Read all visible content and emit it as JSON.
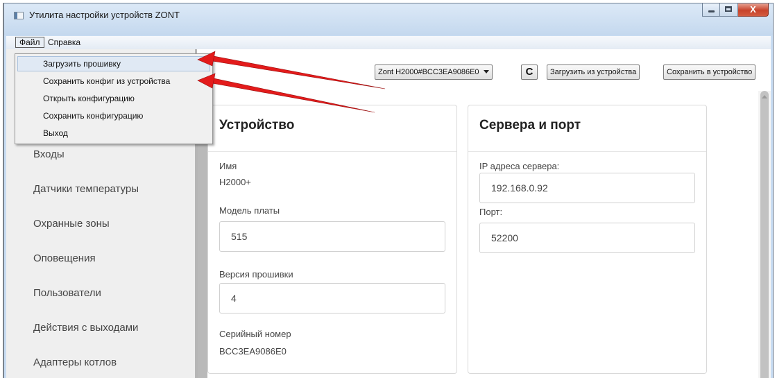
{
  "window": {
    "title": "Утилита настройки устройств ZONT",
    "close_glyph": "X"
  },
  "menubar": {
    "file": "Файл",
    "help": "Справка"
  },
  "file_menu": {
    "items": [
      "Загрузить прошивку",
      "Сохранить конфиг из устройства",
      "Открыть конфигурацию",
      "Сохранить конфигурацию",
      "Выход"
    ]
  },
  "toolbar": {
    "device_select": "Zont H2000#BCC3EA9086E0",
    "refresh_glyph": "C",
    "load_button": "Загрузить из устройства",
    "save_button": "Сохранить в устройство"
  },
  "sidebar": {
    "items": [
      "Входы",
      "Датчики температуры",
      "Охранные зоны",
      "Оповещения",
      "Пользователи",
      "Действия с выходами",
      "Адаптеры котлов"
    ]
  },
  "device_card": {
    "title": "Устройство",
    "name_label": "Имя",
    "name_value": "H2000+",
    "board_label": "Модель платы",
    "board_value": "515",
    "firmware_label": "Версия прошивки",
    "firmware_value": "4",
    "serial_label": "Серийный номер",
    "serial_value": "BCC3EA9086E0"
  },
  "server_card": {
    "title": "Сервера и порт",
    "ip_label": "IP адреса сервера:",
    "ip_value": "192.168.0.92",
    "port_label": "Порт:",
    "port_value": "52200"
  },
  "colors": {
    "arrow": "#e31b1b",
    "title_bar": "#c8dcf2",
    "sidebar": "#efefef"
  }
}
